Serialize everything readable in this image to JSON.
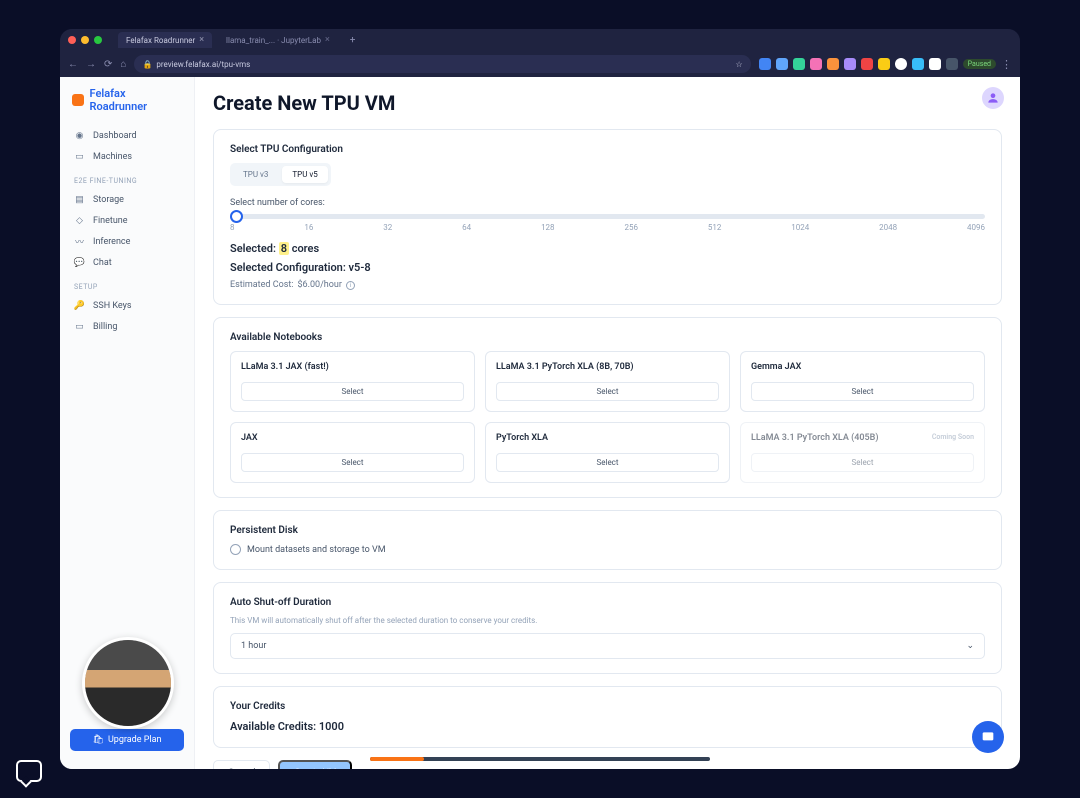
{
  "browser": {
    "tabs": [
      {
        "title": "Felafax Roadrunner",
        "active": true
      },
      {
        "title": "llama_train_... · JupyterLab",
        "active": false
      }
    ],
    "url": "preview.felafax.ai/tpu-vms",
    "paused_label": "Paused"
  },
  "brand": "Felafax Roadrunner",
  "sidebar": {
    "main": [
      {
        "label": "Dashboard",
        "icon": "dashboard"
      },
      {
        "label": "Machines",
        "icon": "machines"
      }
    ],
    "heading1": "E2E Fine-Tuning",
    "finetune": [
      {
        "label": "Storage",
        "icon": "storage"
      },
      {
        "label": "Finetune",
        "icon": "finetune"
      },
      {
        "label": "Inference",
        "icon": "inference"
      },
      {
        "label": "Chat",
        "icon": "chat"
      }
    ],
    "heading2": "Setup",
    "setup": [
      {
        "label": "SSH Keys",
        "icon": "sshkeys"
      },
      {
        "label": "Billing",
        "icon": "billing"
      }
    ],
    "upgrade": "Upgrade Plan"
  },
  "page": {
    "title": "Create New TPU VM",
    "config": {
      "select_label": "Select TPU Configuration",
      "tabs": [
        "TPU v3",
        "TPU v5"
      ],
      "active_tab": 1,
      "cores_label": "Select number of cores:",
      "ticks": [
        "8",
        "16",
        "32",
        "64",
        "128",
        "256",
        "512",
        "1024",
        "2048",
        "4096"
      ],
      "selected_prefix": "Selected: ",
      "selected_value": "8",
      "selected_suffix": " cores",
      "config_line": "Selected Configuration: v5-8",
      "cost_prefix": "Estimated Cost: ",
      "cost_value": "$6.00/hour"
    },
    "notebooks": {
      "heading": "Available Notebooks",
      "items": [
        {
          "title": "LLaMa 3.1 JAX (fast!)",
          "select": "Select",
          "disabled": false
        },
        {
          "title": "LLaMA 3.1 PyTorch XLA (8B, 70B)",
          "select": "Select",
          "disabled": false
        },
        {
          "title": "Gemma JAX",
          "select": "Select",
          "disabled": false
        },
        {
          "title": "JAX",
          "select": "Select",
          "disabled": false
        },
        {
          "title": "PyTorch XLA",
          "select": "Select",
          "disabled": false
        },
        {
          "title": "LLaMA 3.1 PyTorch XLA (405B)",
          "select": "Select",
          "disabled": true,
          "badge": "Coming Soon"
        }
      ]
    },
    "disk": {
      "heading": "Persistent Disk",
      "option": "Mount datasets and storage to VM"
    },
    "shutoff": {
      "heading": "Auto Shut-off Duration",
      "help": "This VM will automatically shut off after the selected duration to conserve your credits.",
      "value": "1 hour"
    },
    "credits": {
      "heading": "Your Credits",
      "available_label": "Available Credits: ",
      "available_value": "1000"
    },
    "actions": {
      "cancel": "Cancel",
      "create": "Create VM"
    }
  },
  "colors": {
    "accent": "#2563eb",
    "orange": "#f97316",
    "highlight": "#fef08a"
  }
}
